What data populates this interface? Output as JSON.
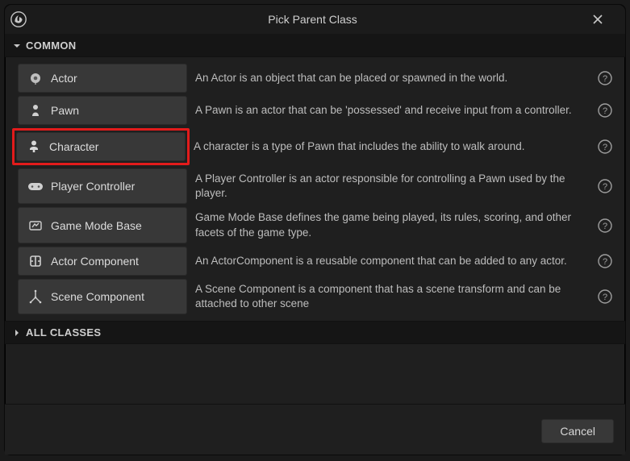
{
  "window": {
    "title": "Pick Parent Class"
  },
  "sections": {
    "common": {
      "header": "COMMON",
      "items": [
        {
          "name": "Actor",
          "description": "An Actor is an object that can be placed or spawned in the world."
        },
        {
          "name": "Pawn",
          "description": "A Pawn is an actor that can be 'possessed' and receive input from a controller."
        },
        {
          "name": "Character",
          "description": "A character is a type of Pawn that includes the ability to walk around."
        },
        {
          "name": "Player Controller",
          "description": "A Player Controller is an actor responsible for controlling a Pawn used by the player."
        },
        {
          "name": "Game Mode Base",
          "description": "Game Mode Base defines the game being played, its rules, scoring, and other facets of the game type."
        },
        {
          "name": "Actor Component",
          "description": "An ActorComponent is a reusable component that can be added to any actor."
        },
        {
          "name": "Scene Component",
          "description": "A Scene Component is a component that has a scene transform and can be attached to other scene"
        }
      ]
    },
    "all_classes": {
      "header": "ALL CLASSES"
    }
  },
  "buttons": {
    "cancel": "Cancel"
  },
  "highlighted_index": 2
}
